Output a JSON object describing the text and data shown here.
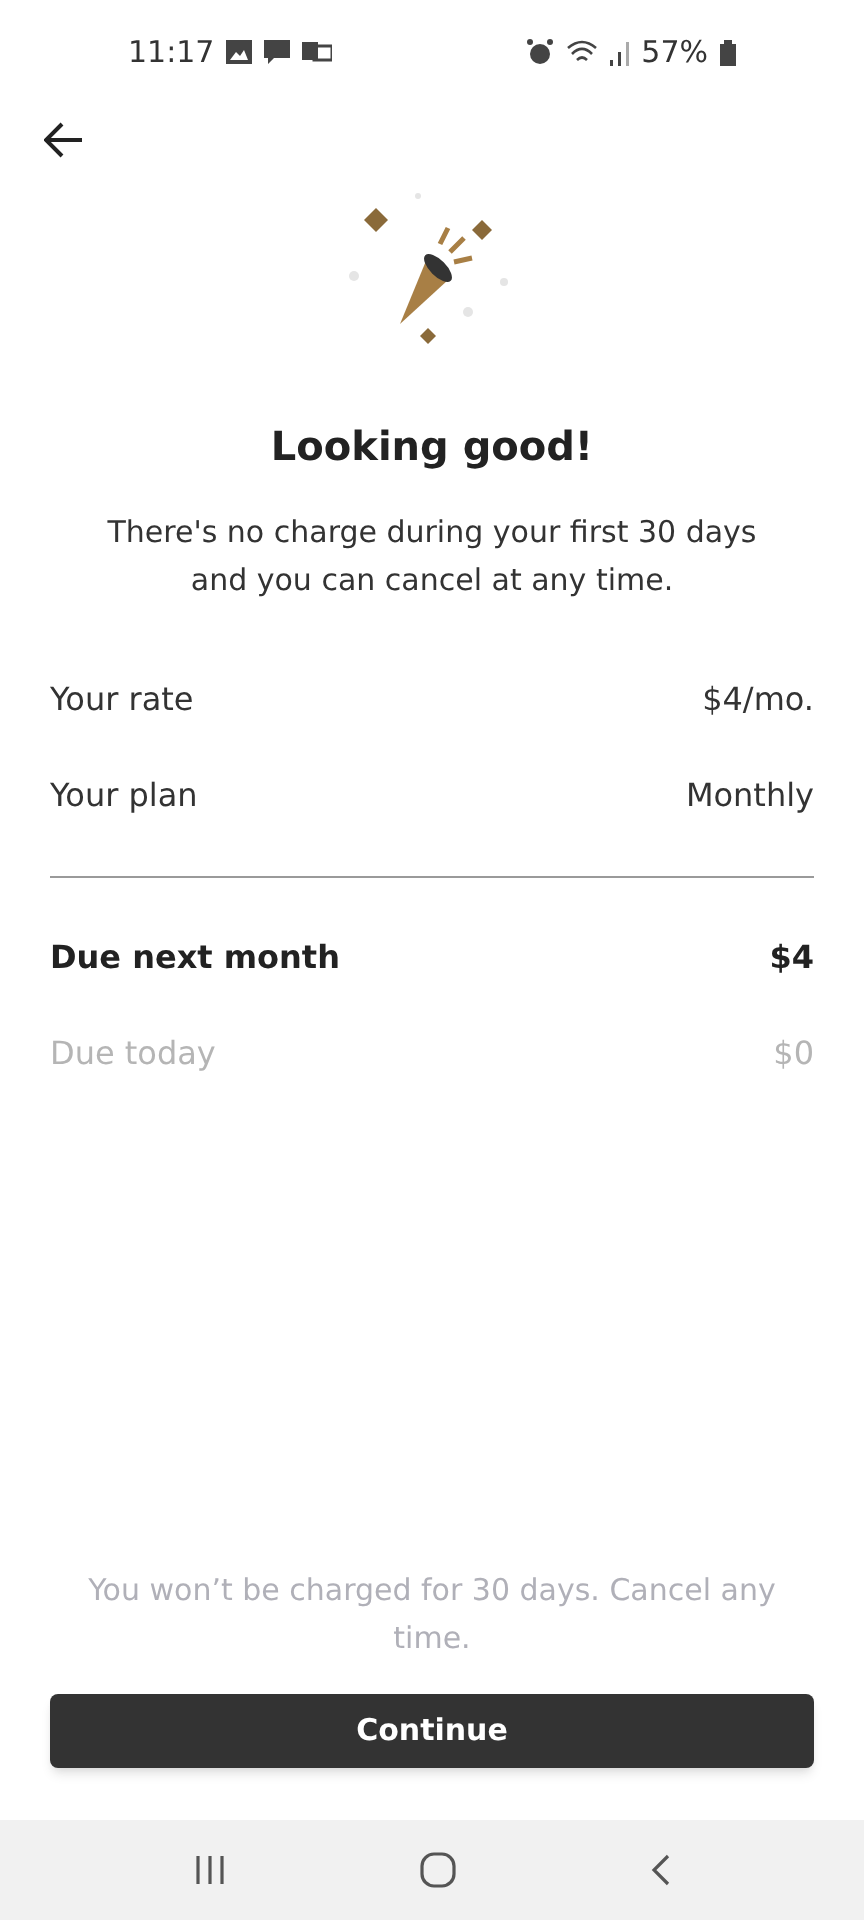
{
  "status_bar": {
    "time": "11:17",
    "battery": "57%"
  },
  "title": "Looking good!",
  "subtitle": "There's no charge during your first 30 days and you can cancel at any time.",
  "summary": [
    {
      "kind": "normal",
      "label": "Your rate",
      "value": "$4/mo."
    },
    {
      "kind": "normal",
      "label": "Your plan",
      "value": "Monthly"
    },
    {
      "kind": "divider"
    },
    {
      "kind": "total",
      "label": "Due next month",
      "value": "$4"
    },
    {
      "kind": "muted",
      "label": "Due today",
      "value": "$0"
    }
  ],
  "footnote": "You won’t be charged for 30 days. Cancel any time.",
  "button": "Continue"
}
